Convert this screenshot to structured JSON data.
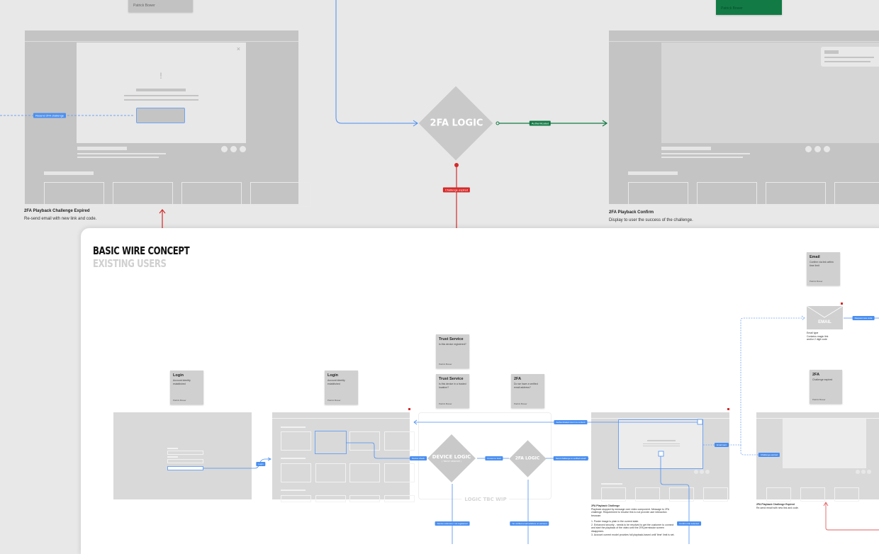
{
  "top_notes": [
    {
      "author": "Patrick Bower"
    },
    {
      "author": "Patrick Bower"
    }
  ],
  "top_left": {
    "title": "2FA Playback Challenge Expired",
    "desc": "Re-send email with new link and code.",
    "close": "×",
    "alert": "!",
    "flow_label": "Resend 2FA challenge"
  },
  "top_right": {
    "title": "2FA Playback Confirm",
    "desc": "Display to user the success of the challenge."
  },
  "logic": {
    "title": "2FA LOGIC",
    "success_label": "Authenticated",
    "fail_label": "Challenge expired"
  },
  "colors": {
    "blue": "#4a8ef0",
    "green": "#127a45",
    "red": "#d42a2a"
  },
  "panel": {
    "title": "BASIC WIRE CONCEPT",
    "subtitle": "EXISTING USERS",
    "stickies": [
      {
        "title": "Login",
        "body": "Account identity established",
        "author": "Patrick Bower"
      },
      {
        "title": "Login",
        "body": "Account identity established",
        "author": "Patrick Bower"
      },
      {
        "title": "Trust Service",
        "body": "Is this device registered?",
        "author": "Patrick Bower"
      },
      {
        "title": "Trust Service",
        "body": "Is this device in a trusted location?",
        "author": "Patrick Bower"
      },
      {
        "title": "2FA",
        "body": "Do we have a verified email address?",
        "author": "Patrick Bower"
      },
      {
        "title": "Email",
        "body": "Confirm via link within time limit",
        "author": "Patrick Bower"
      },
      {
        "title": "2FA",
        "body": "Challenge expired",
        "author": "Patrick Bower"
      }
    ],
    "device_logic": "DEVICE LOGIC",
    "device_logic_sub": "( TRUST SERVICE )",
    "twofa_logic": "2FA LOGIC",
    "logic_group": "LOGIC TBC WIP",
    "email_label": "EMAIL",
    "email_caption": "Email type\nContains magic link\nand/or 2 digit code",
    "flow_labels": {
      "login": "Login",
      "device": "Device check",
      "known": "Known to trust",
      "send_challenge": "Send challenge to verified email",
      "back": "Authenticated return to content",
      "unknown": "Device unknown / not registered",
      "no_email": "No verified email address on account",
      "confirm": "Confirm link selected",
      "email_sent": "Email sent",
      "expired": "Challenge expired",
      "new_code": "Request new code"
    },
    "caption_challenge": {
      "title": "2FA Playback Challenge",
      "desc": "Playback stopped by message over video component. Message to 2FA challenge. Requirement to resolve this to not provide user interaction because.",
      "items": [
        "1. Poster image is plain in the current state.",
        "2. Enhanced security - needs to be resolved to get the customer to connect and start the playback of the video until the 2FA permission screen disappears.",
        "3. Account current model provides full playback-based until 'time' limit is set."
      ]
    },
    "caption_expired": {
      "title": "2FA Playback Challenge Expired",
      "desc": "Re-send email with new link and code."
    }
  }
}
